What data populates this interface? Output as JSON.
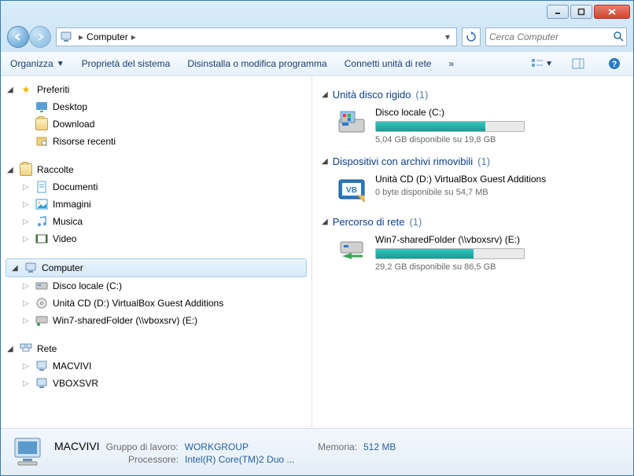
{
  "window": {
    "min_tip": "Minimize",
    "max_tip": "Maximize",
    "close_tip": "Close"
  },
  "address": {
    "location": "Computer",
    "sep": "▸",
    "refresh_tip": "Refresh"
  },
  "search": {
    "placeholder": "Cerca Computer"
  },
  "toolbar": {
    "organize": "Organizza",
    "sysprops": "Proprietà del sistema",
    "uninstall": "Disinstalla o modifica programma",
    "mapnet": "Connetti unità di rete",
    "overflow": "»"
  },
  "sidebar": {
    "favorites": {
      "label": "Preferiti",
      "items": [
        {
          "label": "Desktop"
        },
        {
          "label": "Download"
        },
        {
          "label": "Risorse recenti"
        }
      ]
    },
    "libraries": {
      "label": "Raccolte",
      "items": [
        {
          "label": "Documenti"
        },
        {
          "label": "Immagini"
        },
        {
          "label": "Musica"
        },
        {
          "label": "Video"
        }
      ]
    },
    "computer": {
      "label": "Computer",
      "items": [
        {
          "label": "Disco locale (C:)"
        },
        {
          "label": "Unità CD (D:) VirtualBox Guest Additions"
        },
        {
          "label": "Win7-sharedFolder (\\\\vboxsrv) (E:)"
        }
      ]
    },
    "network": {
      "label": "Rete",
      "items": [
        {
          "label": "MACVIVI"
        },
        {
          "label": "VBOXSVR"
        }
      ]
    }
  },
  "main": {
    "hdd": {
      "title": "Unità disco rigido",
      "count": "(1)",
      "drives": [
        {
          "name": "Disco locale (C:)",
          "free": "5,04 GB disponibile su 19,8 GB",
          "pct": 74
        }
      ]
    },
    "removable": {
      "title": "Dispositivi con archivi rimovibili",
      "count": "(1)",
      "drives": [
        {
          "name": "Unità CD (D:) VirtualBox Guest Additions",
          "free": "0 byte disponibile su 54,7 MB"
        }
      ]
    },
    "netloc": {
      "title": "Percorso di rete",
      "count": "(1)",
      "drives": [
        {
          "name": "Win7-sharedFolder (\\\\vboxsrv) (E:)",
          "free": "29,2 GB disponibile su 86,5 GB",
          "pct": 66
        }
      ]
    }
  },
  "details": {
    "hostname": "MACVIVI",
    "workgroup_lbl": "Gruppo di lavoro:",
    "workgroup_val": "WORKGROUP",
    "mem_lbl": "Memoria:",
    "mem_val": "512 MB",
    "cpu_lbl": "Processore:",
    "cpu_val": "Intel(R) Core(TM)2 Duo ..."
  }
}
